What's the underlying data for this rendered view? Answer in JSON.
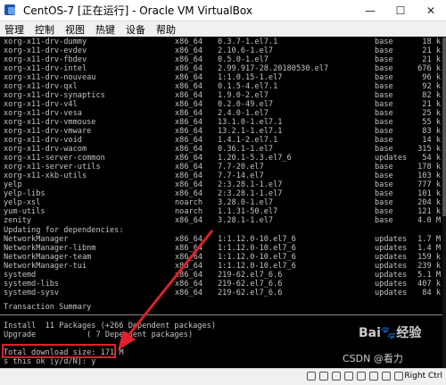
{
  "window": {
    "title": "CentOS-7 [正在运行] - Oracle VM VirtualBox",
    "minimize": "—",
    "maximize": "☐",
    "close": "✕"
  },
  "menu": [
    "管理",
    "控制",
    "视图",
    "热键",
    "设备",
    "帮助"
  ],
  "packages": [
    [
      "xorg-x11-drv-dummy",
      "x86_64",
      "0.3.7-1.el7.1",
      "base",
      "18 k"
    ],
    [
      "xorg-x11-drv-evdev",
      "x86_64",
      "2.10.6-1.el7",
      "base",
      "21 k"
    ],
    [
      "xorg-x11-drv-fbdev",
      "x86_64",
      "0.5.0-1.el7",
      "base",
      "21 k"
    ],
    [
      "xorg-x11-drv-intel",
      "x86_64",
      "2.99.917-28.20180530.el7",
      "base",
      "676 k"
    ],
    [
      "xorg-x11-drv-nouveau",
      "x86_64",
      "1:1.0.15-1.el7",
      "base",
      "96 k"
    ],
    [
      "xorg-x11-drv-qxl",
      "x86_64",
      "0.1.5-4.el7.1",
      "base",
      "92 k"
    ],
    [
      "xorg-x11-drv-synaptics",
      "x86_64",
      "1.9.0-2.el7",
      "base",
      "82 k"
    ],
    [
      "xorg-x11-drv-v4l",
      "x86_64",
      "0.2.0-49.el7",
      "base",
      "21 k"
    ],
    [
      "xorg-x11-drv-vesa",
      "x86_64",
      "2.4.0-1.el7",
      "base",
      "25 k"
    ],
    [
      "xorg-x11-drv-vmmouse",
      "x86_64",
      "13.1.0-1.el7.1",
      "base",
      "55 k"
    ],
    [
      "xorg-x11-drv-vmware",
      "x86_64",
      "13.2.1-1.el7.1",
      "base",
      "83 k"
    ],
    [
      "xorg-x11-drv-void",
      "x86_64",
      "1.4.1-2.el7.1",
      "base",
      "14 k"
    ],
    [
      "xorg-x11-drv-wacom",
      "x86_64",
      "0.36.1-1.el7",
      "base",
      "315 k"
    ],
    [
      "xorg-x11-server-common",
      "x86_64",
      "1.20.1-5.3.el7_6",
      "updates",
      "54 k"
    ],
    [
      "xorg-x11-server-utils",
      "x86_64",
      "7.7-20.el7",
      "base",
      "178 k"
    ],
    [
      "xorg-x11-xkb-utils",
      "x86_64",
      "7.7-14.el7",
      "base",
      "103 k"
    ],
    [
      "yelp",
      "x86_64",
      "2:3.28.1-1.el7",
      "base",
      "777 k"
    ],
    [
      "yelp-libs",
      "x86_64",
      "2:3.28.1-1.el7",
      "base",
      "101 k"
    ],
    [
      "yelp-xsl",
      "noarch",
      "3.28.0-1.el7",
      "base",
      "204 k"
    ],
    [
      "yum-utils",
      "noarch",
      "1.1.31-50.el7",
      "base",
      "121 k"
    ],
    [
      "zenity",
      "x86_64",
      "3.28.1-1.el7",
      "base",
      "4.0 M"
    ]
  ],
  "deps_header": "Updating for dependencies:",
  "deps": [
    [
      "NetworkManager",
      "x86_64",
      "1:1.12.0-10.el7_6",
      "updates",
      "1.7 M"
    ],
    [
      "NetworkManager-libnm",
      "x86_64",
      "1:1.12.0-10.el7_6",
      "updates",
      "1.4 M"
    ],
    [
      "NetworkManager-team",
      "x86_64",
      "1:1.12.0-10.el7_6",
      "updates",
      "159 k"
    ],
    [
      "NetworkManager-tui",
      "x86_64",
      "1:1.12.0-10.el7_6",
      "updates",
      "239 k"
    ],
    [
      "systemd",
      "x86_64",
      "219-62.el7_6.6",
      "updates",
      "5.1 M"
    ],
    [
      "systemd-libs",
      "x86_64",
      "219-62.el7_6.6",
      "updates",
      "407 k"
    ],
    [
      "systemd-sysv",
      "x86_64",
      "219-62.el7_6.6",
      "updates",
      "84 k"
    ]
  ],
  "summary": {
    "title": "Transaction Summary",
    "install": "Install  11 Packages (+266 Dependent packages)",
    "upgrade": "Upgrade           ( 7 Dependent packages)",
    "total": "Total download size: 171 M",
    "prompt": "s this ok [y/d/N]: y"
  },
  "watermark": {
    "baidu": "Bai",
    "jingyan": "经验",
    "csdn": "CSDN @看力"
  },
  "status": {
    "host_key": "Right Ctrl"
  },
  "colors": {
    "highlight": "#e0202a",
    "terminal_text": "#c4c4c4"
  }
}
